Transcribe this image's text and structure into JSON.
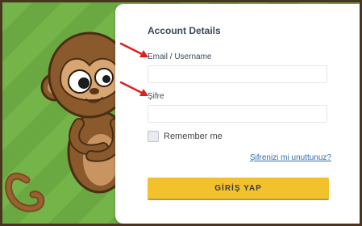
{
  "card": {
    "title": "Account Details",
    "email_label": "Email / Username",
    "email_value": "",
    "password_label": "Şifre",
    "password_value": "",
    "remember_label": "Remember me",
    "forgot_link": "Şifrenizi mi unuttunuz?",
    "login_button": "GİRİŞ YAP"
  },
  "colors": {
    "background_green": "#6fae45",
    "frame_border": "#4a3320",
    "button_yellow": "#f2c12e",
    "link_blue": "#2f6db3",
    "arrow_red": "#e01e1e"
  },
  "icons": [
    "monkey-mascot",
    "red-arrow-icon"
  ]
}
